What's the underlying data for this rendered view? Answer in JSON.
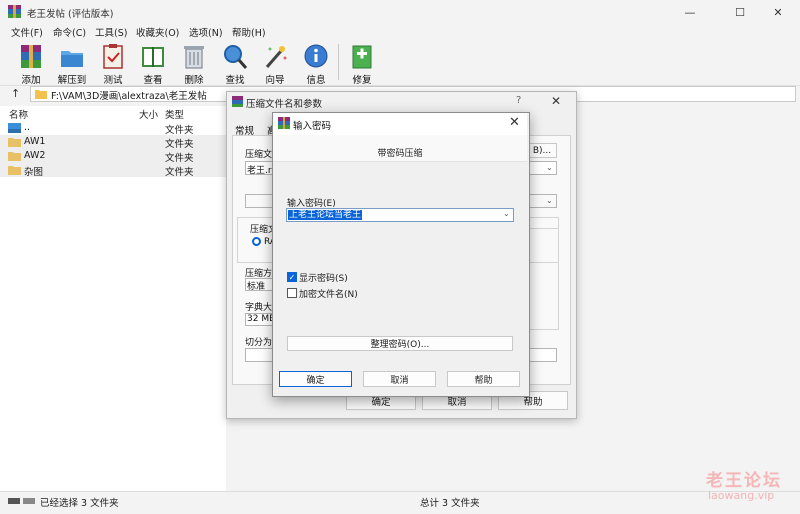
{
  "window": {
    "title": "老王发帖 (评估版本)",
    "minimize_icon": "—",
    "maximize_icon": "☐",
    "close_icon": "✕"
  },
  "menu": [
    "文件(F)",
    "命令(C)",
    "工具(S)",
    "收藏夹(O)",
    "选项(N)",
    "帮助(H)"
  ],
  "toolbar": [
    {
      "label": "添加",
      "icon": "add-archive-icon"
    },
    {
      "label": "解压到",
      "icon": "extract-folder-icon"
    },
    {
      "label": "测试",
      "icon": "test-clipboard-icon"
    },
    {
      "label": "查看",
      "icon": "view-book-icon"
    },
    {
      "label": "删除",
      "icon": "trash-icon"
    },
    {
      "label": "查找",
      "icon": "find-magnifier-icon"
    },
    {
      "label": "向导",
      "icon": "wizard-wand-icon"
    },
    {
      "label": "信息",
      "icon": "info-icon"
    },
    {
      "label": "修复",
      "icon": "repair-kit-icon"
    }
  ],
  "address": {
    "up_icon": "↑",
    "path": "F:\\VAM\\3D漫画\\alextraza\\老王发帖"
  },
  "list": {
    "columns": {
      "name": "名称",
      "size": "大小",
      "type": "类型"
    },
    "rows": [
      {
        "name": "..",
        "type": "文件夹",
        "selected": false,
        "icon": "parent-folder-icon"
      },
      {
        "name": "AW1",
        "type": "文件夹",
        "selected": true,
        "icon": "folder-icon"
      },
      {
        "name": "AW2",
        "type": "文件夹",
        "selected": true,
        "icon": "folder-icon"
      },
      {
        "name": "杂图",
        "type": "文件夹",
        "selected": true,
        "icon": "folder-icon"
      }
    ]
  },
  "status": {
    "left": "已经选择 3 文件夹",
    "right": "总计 3 文件夹"
  },
  "watermark": {
    "line1": "老王论坛",
    "line2": "laowang.vip"
  },
  "bg_dialog": {
    "title": "压缩文件名和参数",
    "help_icon": "?",
    "close_icon": "✕",
    "tab_general": "常规",
    "tab_partial": "高",
    "archive_name_label": "压缩文",
    "archive_name_value": "老王.ra",
    "browse_button": "B)...",
    "format_label": "压缩文",
    "format_option": "RA",
    "method_label": "压缩方",
    "method_value": "标准",
    "dict_label": "字典大",
    "dict_value": "32 MB",
    "split_label": "切分为",
    "ok": "确定",
    "cancel": "取消",
    "help": "帮助"
  },
  "pw_dialog": {
    "title": "输入密码",
    "close_icon": "✕",
    "heading": "带密码压缩",
    "input_label": "输入密码(E)",
    "input_value": "上老王论坛当老王",
    "dropdown_icon": "⌄",
    "show_password": {
      "label": "显示密码(S)",
      "checked": true
    },
    "encrypt_names": {
      "label": "加密文件名(N)",
      "checked": false
    },
    "manage_button": "整理密码(O)...",
    "ok": "确定",
    "cancel": "取消",
    "help": "帮助"
  }
}
